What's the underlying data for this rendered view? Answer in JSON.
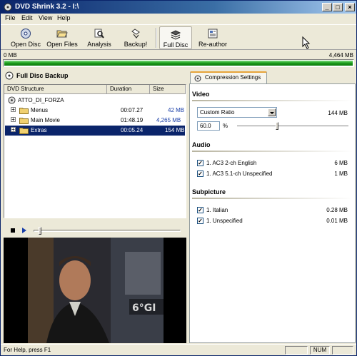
{
  "window": {
    "title": "DVD Shrink 3.2 - I:\\"
  },
  "menu": [
    "File",
    "Edit",
    "View",
    "Help"
  ],
  "toolbar": {
    "open_disc": "Open Disc",
    "open_files": "Open Files",
    "analysis": "Analysis",
    "backup": "Backup!",
    "full_disc": "Full Disc",
    "reauthor": "Re-author"
  },
  "sizebar": {
    "min_label": "0 MB",
    "max_label": "4,464 MB",
    "fill_fraction": 1.0
  },
  "left": {
    "header": "Full Disc Backup",
    "columns": [
      "DVD Structure",
      "Duration",
      "Size"
    ],
    "root": "ATTO_DI_FORZA",
    "rows": [
      {
        "name": "Menus",
        "duration": "00:07.27",
        "size": "42 MB",
        "selected": false
      },
      {
        "name": "Main Movie",
        "duration": "01:48.19",
        "size": "4,265 MB",
        "selected": false
      },
      {
        "name": "Extras",
        "duration": "00:05.24",
        "size": "154 MB",
        "selected": true
      }
    ],
    "player": {
      "position_fraction": 0.03
    }
  },
  "right": {
    "tab": "Compression Settings",
    "video": {
      "title": "Video",
      "mode": "Custom Ratio",
      "size": "144 MB",
      "ratio": "60.0",
      "percent_sign": "%",
      "slider_fraction": 0.36
    },
    "audio": {
      "title": "Audio",
      "items": [
        {
          "label": "1. AC3 2-ch English",
          "size": "6 MB",
          "checked": true
        },
        {
          "label": "1. AC3 5.1-ch Unspecified",
          "size": "1 MB",
          "checked": true
        }
      ]
    },
    "subpicture": {
      "title": "Subpicture",
      "items": [
        {
          "label": "1. Italian",
          "size": "0.28 MB",
          "checked": true
        },
        {
          "label": "1. Unspecified",
          "size": "0.01 MB",
          "checked": true
        }
      ]
    }
  },
  "statusbar": {
    "message": "For Help, press F1",
    "num": "NUM"
  },
  "colors": {
    "selection": "#0a246a",
    "progress": "#1a9a1a",
    "tab_accent": "#e6a43a"
  },
  "icons": [
    "dvd-app-icon",
    "disc-icon",
    "open-folder-icon",
    "magnifier-icon",
    "backup-icon",
    "full-disc-icon",
    "reauthor-icon",
    "folder-icon",
    "dvd-small-icon",
    "settings-tab-icon",
    "mouse-cursor-icon"
  ]
}
